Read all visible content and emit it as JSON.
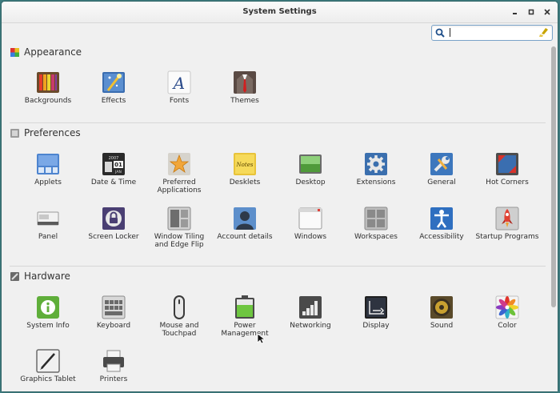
{
  "window": {
    "title": "System Settings",
    "buttons": {
      "minimize": "▪",
      "maximize": "▫",
      "close": "✕"
    }
  },
  "search": {
    "value": "",
    "placeholder": ""
  },
  "sections": {
    "appearance": {
      "title": "Appearance",
      "items": [
        "Backgrounds",
        "Effects",
        "Fonts",
        "Themes"
      ]
    },
    "preferences": {
      "title": "Preferences",
      "items": [
        "Applets",
        "Date & Time",
        "Preferred Applications",
        "Desklets",
        "Desktop",
        "Extensions",
        "General",
        "Hot Corners",
        "Panel",
        "Screen Locker",
        "Window Tiling and Edge Flip",
        "Account details",
        "Windows",
        "Workspaces",
        "Accessibility",
        "Startup Programs"
      ]
    },
    "hardware": {
      "title": "Hardware",
      "items": [
        "System Info",
        "Keyboard",
        "Mouse and Touchpad",
        "Power Management",
        "Networking",
        "Display",
        "Sound",
        "Color",
        "Graphics Tablet",
        "Printers"
      ]
    }
  },
  "icon_names": {
    "appearance": [
      "backgrounds-icon",
      "effects-icon",
      "fonts-icon",
      "themes-icon"
    ],
    "preferences": [
      "applets-icon",
      "date-time-icon",
      "preferred-applications-icon",
      "desklets-icon",
      "desktop-icon",
      "extensions-icon",
      "general-icon",
      "hot-corners-icon",
      "panel-icon",
      "screen-locker-icon",
      "window-tiling-icon",
      "account-details-icon",
      "windows-icon",
      "workspaces-icon",
      "accessibility-icon",
      "startup-programs-icon"
    ],
    "hardware": [
      "system-info-icon",
      "keyboard-icon",
      "mouse-touchpad-icon",
      "power-management-icon",
      "networking-icon",
      "display-icon",
      "sound-icon",
      "color-icon",
      "graphics-tablet-icon",
      "printers-icon"
    ]
  },
  "date_time_icon_text": {
    "year": "2007",
    "day": "01",
    "month": "JAN"
  },
  "desklets_icon_text": "Notes",
  "fonts_icon_text": "A",
  "colors": {
    "accent": "#3b73b9",
    "background": "#f0f0f0",
    "desktop": "#3e7d80"
  }
}
